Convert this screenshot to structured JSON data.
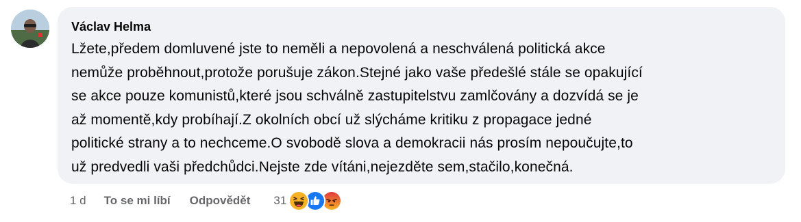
{
  "comment": {
    "author": "Václav Helma",
    "text": "Lžete,předem domluvené jste to neměli a nepovolená a neschválená politická akce\nnemůže proběhnout,protože porušuje zákon.Stejné jako vaše předešlé stále se opakující\nse akce pouze komunistů,které jsou schválně zastupitelstvu zamlčovány a dozvídá se je\naž momentě,kdy probíhají.Z okolních obcí už slýcháme kritiku z propagace jedné\npolitické strany a to nechceme.O svobodě slova a demokracii nás prosím nepoučujte,to\nuž predvedli vaši předchůdci.Nejste zde vítáni,nejezděte sem,stačilo,konečná.",
    "time": "1 d",
    "like_label": "To se mi líbí",
    "reply_label": "Odpovědět",
    "reaction_count": "31",
    "reactions": [
      "haha-icon",
      "like-icon",
      "angry-icon"
    ],
    "colors": {
      "bubble": "#f0f2f5",
      "meta_text": "#65676b",
      "like_blue": "#1877f2",
      "haha_yellow": "#f7b125",
      "angry_orange": "#e9710f"
    }
  }
}
